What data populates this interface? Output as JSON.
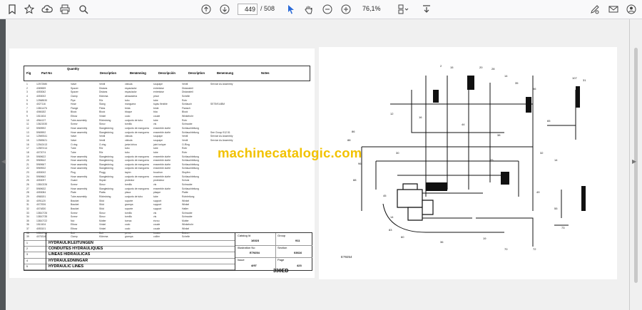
{
  "toolbar": {
    "page_current": "449",
    "page_total": "/ 508",
    "zoom": "76,1%"
  },
  "parts_page": {
    "header": {
      "fig": "Fig",
      "part_no": "Part No",
      "quantity": "Quantity",
      "description": "Description",
      "benamning": "Benämning",
      "descripcion": "Descripción",
      "description_fr": "Description",
      "benennung": "Benennung",
      "notes": "Notes"
    },
    "rows": [
      {
        "fig": "1",
        "part": "12572580",
        "d1": "Valve",
        "d2": "Ventil",
        "d3": "válvula",
        "d4": "soupape",
        "d5": "Ventil",
        "note": "Service As Assembly"
      },
      {
        "fig": "2",
        "part": "4369659",
        "d1": "Spacer",
        "d2": "Distans",
        "d3": "espaciador",
        "d4": "entretoise",
        "d5": "Distanzteil",
        "note": ""
      },
      {
        "fig": "3",
        "part": "4053062",
        "d1": "Spacer",
        "d2": "Distans",
        "d3": "espaciador",
        "d4": "entretoise",
        "d5": "Distanzteil",
        "note": ""
      },
      {
        "fig": "4",
        "part": "4053002",
        "d1": "Clamp",
        "d2": "Klämma",
        "d3": "abrazadera",
        "d4": "pince",
        "d5": "Schelle",
        "note": ""
      },
      {
        "fig": "5",
        "part": "12568530",
        "d1": "Pipe",
        "d2": "Rör",
        "d3": "tubo",
        "d4": "tube",
        "d5": "Rohr",
        "note": ""
      },
      {
        "fig": "6",
        "part": "4027116",
        "d1": "Hose",
        "d2": "Slang",
        "d3": "manguera",
        "d4": "tuyau flexible",
        "d5": "Schlauch",
        "note": "SE75/914BM"
      },
      {
        "fig": "7",
        "part": "13811476",
        "d1": "Flange",
        "d2": "Fläns",
        "d3": "brida",
        "d4": "bride",
        "d5": "Flansch",
        "note": ""
      },
      {
        "fig": "8",
        "part": "4066182",
        "d1": "Block",
        "d2": "Block",
        "d3": "bloque",
        "d4": "bloc",
        "d5": "Block",
        "note": ""
      },
      {
        "fig": "9",
        "part": "1510434",
        "d1": "Elbow",
        "d2": "Vinkel",
        "d3": "codo",
        "d4": "coude",
        "d5": "Winkelrohr",
        "note": ""
      },
      {
        "fig": "10",
        "part": "4964137",
        "d1": "Tube assembly",
        "d2": "Rörledning",
        "d3": "conjunto de tubo",
        "d4": "tube",
        "d5": "Rohr",
        "note": ""
      },
      {
        "fig": "11",
        "part": "13621530",
        "d1": "Screw",
        "d2": "Skruv",
        "d3": "tornillo",
        "d4": "vis",
        "d5": "Schraube",
        "note": ""
      },
      {
        "fig": "12",
        "part": "5969592",
        "d1": "Hose assembly",
        "d2": "Slangledning",
        "d3": "conjunto de manguera",
        "d4": "ensemble durite",
        "d5": "Schlauchleitung",
        "note": ""
      },
      {
        "fig": "13",
        "part": "5969592",
        "d1": "Hose assembly",
        "d2": "Slangledning",
        "d3": "conjunto de manguera",
        "d4": "ensemble durite",
        "d5": "Schlauchleitung",
        "note": "See Group 912.51"
      },
      {
        "fig": "14",
        "part": "12569341",
        "d1": "Valve",
        "d2": "Ventil",
        "d3": "válvula",
        "d4": "soupape",
        "d5": "Ventil",
        "note": "Service As Assembly"
      },
      {
        "fig": "15",
        "part": "12569621",
        "d1": "Valve",
        "d2": "Ventil",
        "d3": "válvula",
        "d4": "soupape",
        "d5": "Ventil",
        "note": "Service As Assembly"
      },
      {
        "fig": "16",
        "part": "12542413",
        "d1": "O-ring",
        "d2": "O-ring",
        "d3": "junta tórica",
        "d4": "joint torique",
        "d5": "O-Ring",
        "note": ""
      },
      {
        "fig": "17",
        "part": "12587414",
        "d1": "Tube",
        "d2": "Rör",
        "d3": "tubo",
        "d4": "tube",
        "d5": "Rohr",
        "note": ""
      },
      {
        "fig": "18",
        "part": "4072074",
        "d1": "Tube",
        "d2": "Rör",
        "d3": "tubo",
        "d4": "tube",
        "d5": "Rohr",
        "note": ""
      },
      {
        "fig": "19",
        "part": "5969622",
        "d1": "Hose assembly",
        "d2": "Slangledning",
        "d3": "conjunto de manguera",
        "d4": "ensemble durite",
        "d5": "Schlauchleitung",
        "note": ""
      },
      {
        "fig": "20",
        "part": "5969642",
        "d1": "Hose assembly",
        "d2": "Slangledning",
        "d3": "conjunto de manguera",
        "d4": "ensemble durite",
        "d5": "Schlauchleitung",
        "note": ""
      },
      {
        "fig": "21",
        "part": "5969667",
        "d1": "Hose assembly",
        "d2": "Slangledning",
        "d3": "conjunto de manguera",
        "d4": "ensemble durite",
        "d5": "Schlauchleitung",
        "note": ""
      },
      {
        "fig": "22",
        "part": "5969532",
        "d1": "Hose assembly",
        "d2": "Slangledning",
        "d3": "conjunto de manguera",
        "d4": "ensemble durite",
        "d5": "Schlauchleitung",
        "note": ""
      },
      {
        "fig": "23",
        "part": "4053002",
        "d1": "Plug",
        "d2": "Plugg",
        "d3": "tapón",
        "d4": "bouchon",
        "d5": "Stopfen",
        "note": ""
      },
      {
        "fig": "24",
        "part": "5969662",
        "d1": "Hose assembly",
        "d2": "Slangledning",
        "d3": "conjunto de manguera",
        "d4": "ensemble durite",
        "d5": "Schlauchleitung",
        "note": ""
      },
      {
        "fig": "25",
        "part": "4053097",
        "d1": "Guard",
        "d2": "Skydd",
        "d3": "protector",
        "d4": "protecteur",
        "d5": "Schutz",
        "note": ""
      },
      {
        "fig": "26",
        "part": "13810226",
        "d1": "Screw",
        "d2": "Skruv",
        "d3": "tornillo",
        "d4": "vis",
        "d5": "Schraube",
        "note": ""
      },
      {
        "fig": "27",
        "part": "5969632",
        "d1": "Hose assembly",
        "d2": "Slangledning",
        "d3": "conjunto de manguera",
        "d4": "ensemble durite",
        "d5": "Schlauchleitung",
        "note": ""
      },
      {
        "fig": "28",
        "part": "4053084",
        "d1": "Plate",
        "d2": "Platta",
        "d3": "placa",
        "d4": "plaque",
        "d5": "Platte",
        "note": ""
      },
      {
        "fig": "29",
        "part": "4968151",
        "d1": "Tube assembly",
        "d2": "Rörledning",
        "d3": "conjunto de tubo",
        "d4": "tube",
        "d5": "Rohrleitung",
        "note": ""
      },
      {
        "fig": "30",
        "part": "4091120",
        "d1": "Bracket",
        "d2": "Stöd",
        "d3": "soporte",
        "d4": "support",
        "d5": "Winkel",
        "note": ""
      },
      {
        "fig": "31",
        "part": "4072926",
        "d1": "Bracket",
        "d2": "Stöd",
        "d3": "grampa",
        "d4": "support",
        "d5": "Winkel",
        "note": ""
      },
      {
        "fig": "32",
        "part": "4074830",
        "d1": "Bracket",
        "d2": "Stöd",
        "d3": "soporte",
        "d4": "support",
        "d5": "Halter",
        "note": ""
      },
      {
        "fig": "33",
        "part": "13810726",
        "d1": "Screw",
        "d2": "Skruv",
        "d3": "tornillo",
        "d4": "vis",
        "d5": "Schraube",
        "note": ""
      },
      {
        "fig": "34",
        "part": "13810735",
        "d1": "Screw",
        "d2": "Skruv",
        "d3": "tornillo",
        "d4": "vis",
        "d5": "Schraube",
        "note": ""
      },
      {
        "fig": "35",
        "part": "13810722",
        "d1": "Nut",
        "d2": "Mutter",
        "d3": "tuerca",
        "d4": "écrou",
        "d5": "Mutter",
        "note": ""
      },
      {
        "fig": "36",
        "part": "1510434",
        "d1": "Elbow",
        "d2": "Vinkel",
        "d3": "codo",
        "d4": "coude",
        "d5": "Winkelrohr",
        "note": ""
      },
      {
        "fig": "37",
        "part": "4053101",
        "d1": "Elbow",
        "d2": "Vinkel",
        "d3": "codo",
        "d4": "coude",
        "d5": "Winkel",
        "note": ""
      },
      {
        "fig": "38",
        "part": "13816768",
        "d1": "Bolt",
        "d2": "Bult",
        "d3": "perno",
        "d4": "boulon",
        "d5": "Bolzen",
        "note": ""
      },
      {
        "fig": "39",
        "part": "4075316",
        "d1": "Clamp",
        "d2": "Klämma",
        "d3": "grampa",
        "d4": "collier",
        "d5": "Schelle",
        "note": ""
      }
    ],
    "titles": [
      "HYDRAULIKLEITUNGEN",
      "CONDUITES HYDRAULIQUES",
      "LINEAS HIDRAULICAS",
      "HYDRAULEDNINGAR",
      "HYDRAULIC LINES"
    ],
    "rev_numbers": [
      "1",
      "2",
      "3",
      "4",
      "5"
    ],
    "meta": {
      "catalog_label": "Catalog Id",
      "catalog_value": "16023",
      "group_label": "Group",
      "group_value": "911",
      "illustration_label": "Illustration No",
      "illustration_value": "E79254",
      "section_label": "Section",
      "section_value": "03616",
      "issue_label": "Issue",
      "issue_value": "4/97",
      "page_label": "Page",
      "page_value": "423"
    },
    "model": "330ED"
  },
  "diagram_page": {
    "watermark": "machinecatalogic.com",
    "illustration_ref": "E79254"
  },
  "colors": {
    "watermark": "#f2c200",
    "toolbar_bg": "#f9f9fa",
    "viewer_bg": "#525659"
  }
}
